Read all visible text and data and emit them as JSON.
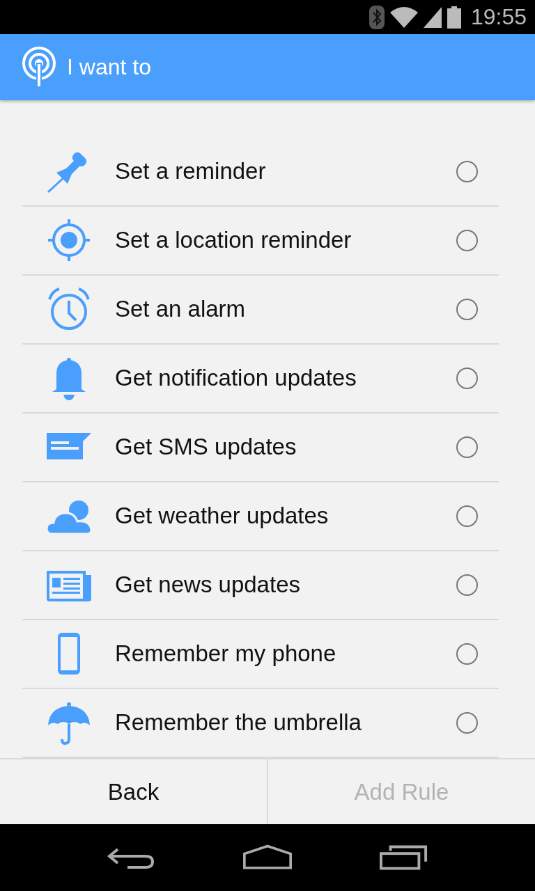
{
  "status_bar": {
    "time": "19:55"
  },
  "app_bar": {
    "title": "I want to"
  },
  "options": [
    {
      "kind": "pin",
      "label": "Set a reminder",
      "selected": false
    },
    {
      "kind": "location",
      "label": "Set a location reminder",
      "selected": false
    },
    {
      "kind": "alarm",
      "label": "Set an alarm",
      "selected": false
    },
    {
      "kind": "bell",
      "label": "Get notification updates",
      "selected": false
    },
    {
      "kind": "sms",
      "label": "Get SMS updates",
      "selected": false
    },
    {
      "kind": "weather",
      "label": "Get weather updates",
      "selected": false
    },
    {
      "kind": "news",
      "label": "Get news updates",
      "selected": false
    },
    {
      "kind": "phone",
      "label": "Remember my phone",
      "selected": false
    },
    {
      "kind": "umbrella",
      "label": "Remember the umbrella",
      "selected": false
    }
  ],
  "buttons": [
    {
      "label": "Back",
      "disabled": false
    },
    {
      "label": "Add Rule",
      "disabled": true
    }
  ]
}
